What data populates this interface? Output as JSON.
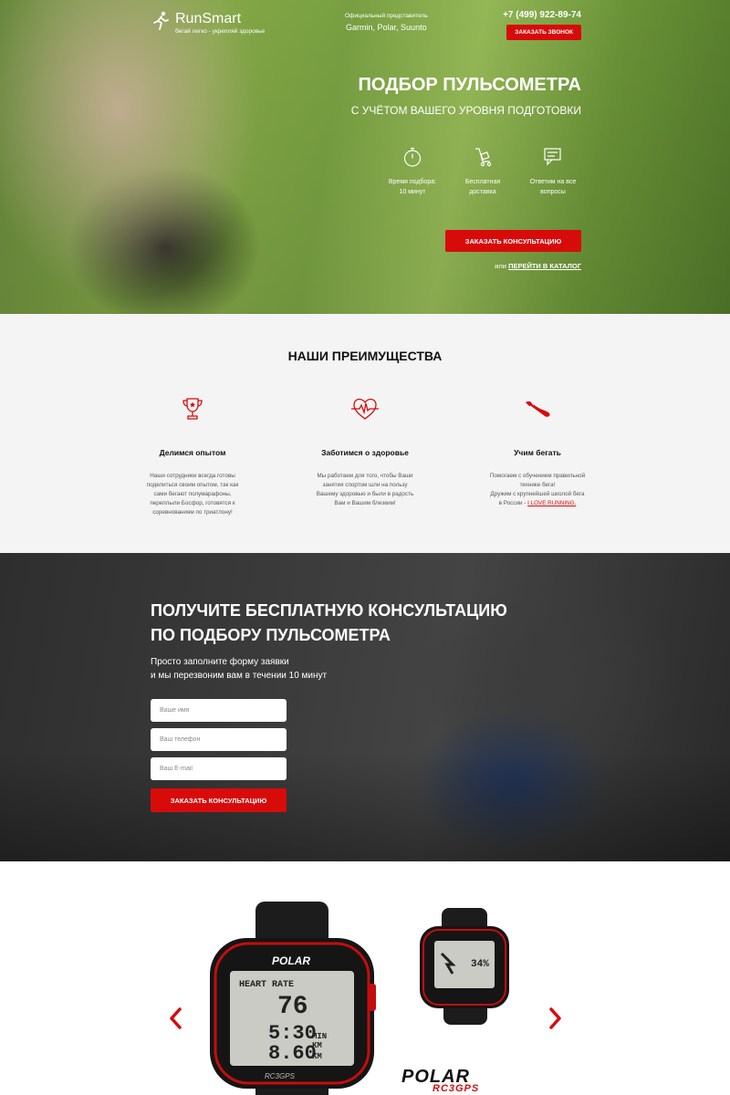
{
  "header": {
    "logo_title": "RunSmart",
    "logo_slogan": "бегай легко - укрепляй здоровье",
    "dealer_label": "Официальный представитель",
    "dealer_brands": "Garmin, Polar, Suunto",
    "phone": "+7 (499) 922-89-74",
    "callback_button": "ЗАКАЗАТЬ ЗВОНОК"
  },
  "hero": {
    "title": "ПОДБОР ПУЛЬСОМЕТРА",
    "subtitle": "С УЧЁТОМ ВАШЕГО УРОВНЯ ПОДГОТОВКИ",
    "features": [
      {
        "icon": "stopwatch-icon",
        "line1": "Время подбора:",
        "line2": "10 минут"
      },
      {
        "icon": "delivery-cart-icon",
        "line1": "Бесплатная",
        "line2": "доставка"
      },
      {
        "icon": "chat-icon",
        "line1": "Ответим на все",
        "line2": "вопросы"
      }
    ],
    "consult_button": "ЗАКАЗАТЬ КОНСУЛЬТАЦИЮ",
    "or_text": "или ",
    "catalog_link": "ПЕРЕЙТИ В КАТАЛОГ"
  },
  "advantages": {
    "title": "НАШИ ПРЕИМУЩЕСТВА",
    "items": [
      {
        "icon": "trophy-icon",
        "name": "Делимся опытом",
        "lines": [
          "Наши сотрудники всегда готовы",
          "поделиться своим опытом, так как",
          "сами бегают полумарафоны,",
          "переплыли Босфор, готовятся к",
          "соревнованиям по триатлону!"
        ]
      },
      {
        "icon": "heart-pulse-icon",
        "name": "Заботимся о здоровье",
        "lines": [
          "Мы работаем для того, чтобы Ваши",
          "занятия спортом шли на пользу",
          "Вашему здоровью и были в радость",
          "Вам и Вашим близким!"
        ]
      },
      {
        "icon": "running-shoe-icon",
        "name": "Учим бегать",
        "lines": [
          "Помогаем с обучением правильной",
          "технике бега!",
          "Дружим с крупнейшей школой бега",
          "в России - "
        ],
        "link": "I LOVE RUNNING."
      }
    ]
  },
  "consult": {
    "title_line1": "ПОЛУЧИТЕ БЕСПЛАТНУЮ КОНСУЛЬТАЦИЮ",
    "title_line2": "ПО ПОДБОРУ ПУЛЬСОМЕТРА",
    "sub_line1": "Просто заполните форму заявки",
    "sub_line2": "и мы перезвоним вам в течении 10 минут",
    "name_placeholder": "Ваше имя",
    "phone_placeholder": "Ваш телефон",
    "email_placeholder": "Ваш E-mail",
    "submit_button": "ЗАКАЗАТЬ КОНСУЛЬТАЦИЮ"
  },
  "carousel": {
    "brand": "POLAR",
    "model": "RC3GPS",
    "watch_screen": {
      "label": "HEART RATE",
      "hr": "76",
      "time": "5:30",
      "dist": "8.60",
      "unit1": "MIN",
      "unit2": "KM",
      "unit3": "KM"
    },
    "colors": {
      "accent": "#d80b0b"
    }
  },
  "colors": {
    "accent": "#d80b0b",
    "light_bg": "#f4f4f4"
  }
}
